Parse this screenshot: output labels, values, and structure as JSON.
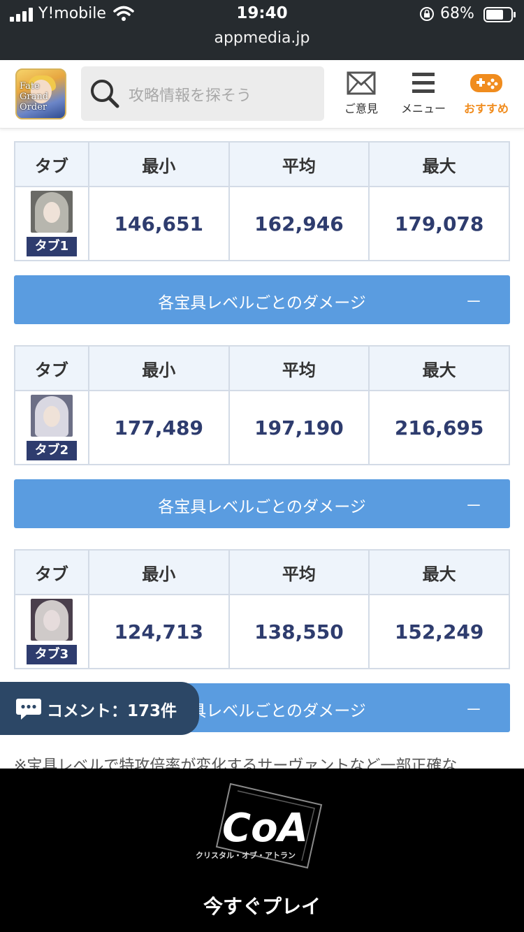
{
  "status_bar": {
    "carrier": "Y!mobile",
    "time": "19:40",
    "battery": "68%"
  },
  "url_bar": {
    "url": "appmedia.jp"
  },
  "header": {
    "logo_text": "Fate Grand Order",
    "search_placeholder": "攻略情報を探そう",
    "feedback_label": "ご意見",
    "menu_label": "メニュー",
    "recommend_label": "おすすめ",
    "accent_color": "#f08c1e"
  },
  "tables": [
    {
      "headers": [
        "タブ",
        "最小",
        "平均",
        "最大"
      ],
      "tab_label": "タブ1",
      "min": "146,651",
      "avg": "162,946",
      "max": "179,078"
    },
    {
      "headers": [
        "タブ",
        "最小",
        "平均",
        "最大"
      ],
      "tab_label": "タブ2",
      "min": "177,489",
      "avg": "197,190",
      "max": "216,695"
    },
    {
      "headers": [
        "タブ",
        "最小",
        "平均",
        "最大"
      ],
      "tab_label": "タブ3",
      "min": "124,713",
      "avg": "138,550",
      "max": "152,249"
    }
  ],
  "accordions": [
    {
      "label": "各宝具レベルごとのダメージ",
      "toggle": "－"
    },
    {
      "label": "各宝具レベルごとのダメージ",
      "toggle": "－"
    },
    {
      "label": "各宝具レベルごとのダメージ",
      "toggle": "－"
    }
  ],
  "comment_button": {
    "label": "コメント：173件"
  },
  "footnote": "※宝具レベルで特攻倍率が変化するサーヴァントなど一部正確な",
  "ad": {
    "title": "CoA",
    "subtitle": "クリスタル・オブ・アトラン",
    "cta": "今すぐプレイ"
  },
  "colors": {
    "accordion_bg": "#5a9ce0",
    "value_text": "#2e3c6e",
    "table_header_bg": "#eef4fb"
  }
}
